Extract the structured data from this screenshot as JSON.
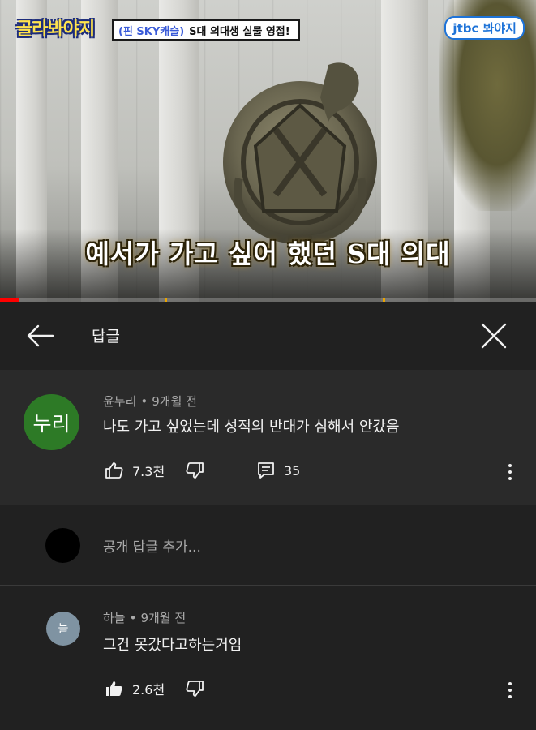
{
  "video": {
    "show_logo": "골라봐야지",
    "banner_tag": "(핀 SKY캐슬)",
    "banner_text": "S대 의대생 실물 영접!",
    "channel_logo": "jtbc 봐야지",
    "subtitle": "예서가 가고 싶어 했던 S대 의대",
    "progress_fraction": 0.035
  },
  "header": {
    "back_icon": "arrow-left-icon",
    "title": "답글",
    "close_icon": "close-icon"
  },
  "parent_comment": {
    "avatar_text": "누리",
    "avatar_color": "#2d7a26",
    "author": "윤누리",
    "separator": "•",
    "time": "9개월 전",
    "text": "나도 가고 싶었는데 성적의 반대가 심해서 안갔음",
    "like_icon": "thumbs-up-outline-icon",
    "likes": "7.3천",
    "dislike_icon": "thumbs-down-outline-icon",
    "reply_icon": "comment-icon",
    "reply_count": "35",
    "more_icon": "more-vertical-icon"
  },
  "add_reply": {
    "placeholder": "공개 답글 추가..."
  },
  "reply_comment": {
    "avatar_text": "늘",
    "avatar_color": "#7f93a2",
    "author": "하늘",
    "separator": "•",
    "time": "9개월 전",
    "text": "그건 못갔다고하는거임",
    "like_icon": "thumbs-up-filled-icon",
    "likes": "2.6천",
    "dislike_icon": "thumbs-down-outline-icon",
    "more_icon": "more-vertical-icon"
  }
}
